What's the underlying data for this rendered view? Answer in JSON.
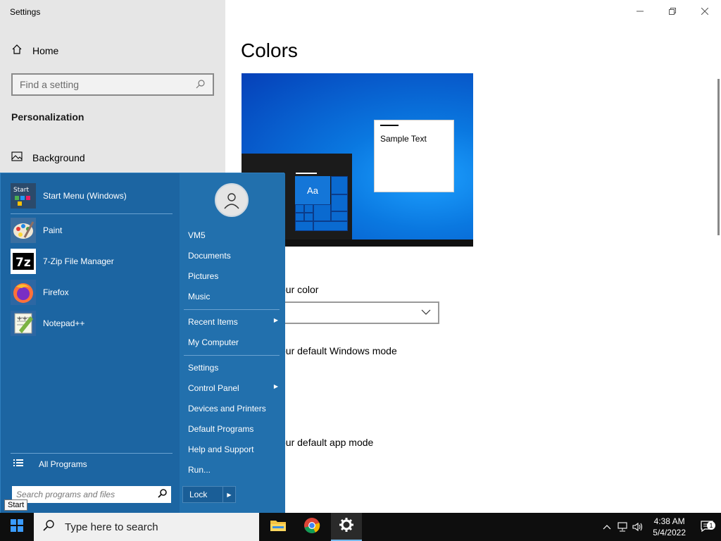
{
  "window": {
    "title": "Settings"
  },
  "sidebar": {
    "home_label": "Home",
    "search_placeholder": "Find a setting",
    "section_title": "Personalization",
    "items": [
      {
        "label": "Background"
      }
    ]
  },
  "main": {
    "title": "Colors",
    "sample_text": "Sample Text",
    "preview_tile_text": "Aa",
    "choose_color_label": "our color",
    "windows_mode_label": "our default Windows mode",
    "app_mode_label": "our default app mode"
  },
  "start_menu": {
    "pinned": [
      {
        "label": "Start Menu (Windows)",
        "icon": "start-menu-app-icon"
      },
      {
        "label": "Paint",
        "icon": "paint-icon"
      },
      {
        "label": "7-Zip File Manager",
        "icon": "7zip-icon"
      },
      {
        "label": "Firefox",
        "icon": "firefox-icon"
      },
      {
        "label": "Notepad++",
        "icon": "notepadpp-icon"
      }
    ],
    "start_tile_text": "Start",
    "sevenzip_text": "7z",
    "notepad_text": "++",
    "all_programs_label": "All Programs",
    "search_placeholder": "Search programs and files",
    "user_name": "VM5",
    "right_items": [
      "Documents",
      "Pictures",
      "Music",
      "Recent Items",
      "My Computer",
      "Settings",
      "Control Panel",
      "Devices and Printers",
      "Default Programs",
      "Help and Support",
      "Run..."
    ],
    "lock_label": "Lock",
    "tooltip": "Start"
  },
  "taskbar": {
    "search_placeholder": "Type here to search",
    "time": "4:38 AM",
    "date": "5/4/2022",
    "notification_count": "1"
  },
  "colors": {
    "start_menu_bg": "#1d6aa8",
    "taskbar_bg": "#0e0e0e",
    "accent": "#0078d7"
  }
}
